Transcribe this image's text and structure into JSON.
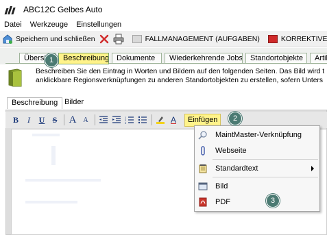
{
  "window": {
    "title": "ABC12C Gelbes Auto"
  },
  "menu": {
    "items": [
      "Datei",
      "Werkzeuge",
      "Einstellungen"
    ]
  },
  "toolbar": {
    "save_close_label": "Speichern und schließen",
    "fallmanagement_label": "FALLMANAGEMENT (AUFGABEN)",
    "korrektive_label": "KORREKTIVE INSTAN"
  },
  "tabs": [
    "Übersicht",
    "Beschreibung",
    "Dokumente",
    "Wiederkehrende Jobs",
    "Standortobjekte",
    "Artik"
  ],
  "active_tab": "Beschreibung",
  "info": {
    "line1": "Beschreiben Sie den Eintrag in Worten und Bildern auf den folgenden Seiten. Das Bild wird t",
    "line2": "anklickbare Regionsverknüpfungen zu anderen Standortobjekten zu erstellen, sofern Unters"
  },
  "subtabs": [
    "Beschreibung",
    "Bilder"
  ],
  "format_bar": {
    "bold": "B",
    "italic": "I",
    "underline": "U",
    "strike": "S",
    "font_grow": "A",
    "font_shrink": "A",
    "font_color": "A",
    "insert_label": "Einfügen"
  },
  "dropdown": {
    "items": [
      {
        "label": "MaintMaster-Verknüpfung",
        "icon": "magnifier-icon"
      },
      {
        "label": "Webseite",
        "icon": "link-icon"
      },
      {
        "label": "Standardtext",
        "icon": "notepad-icon",
        "submenu": true
      },
      {
        "label": "Bild",
        "icon": "image-icon"
      },
      {
        "label": "PDF",
        "icon": "pdf-icon"
      }
    ]
  },
  "callouts": [
    "1",
    "2",
    "3"
  ],
  "colors": {
    "active_tab_bg": "#fff38a",
    "callout_bg": "#4b7a72",
    "tab_border": "#9fb49a"
  }
}
